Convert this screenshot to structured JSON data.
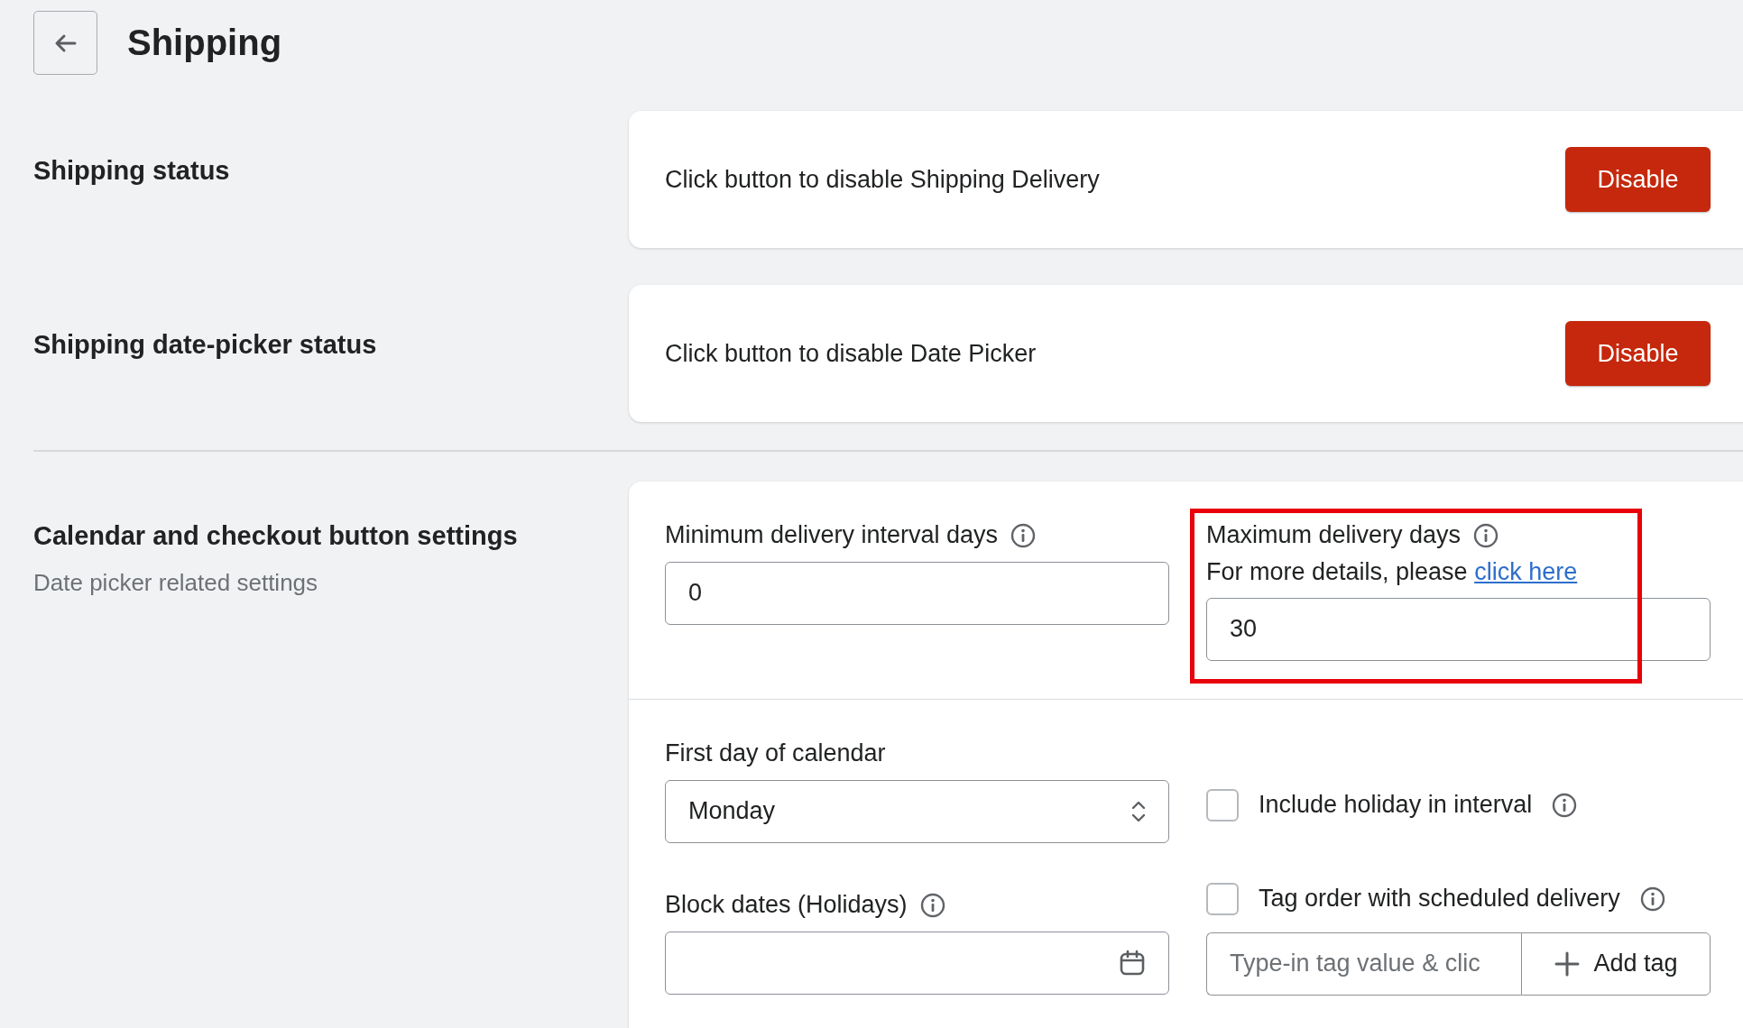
{
  "header": {
    "title": "Shipping"
  },
  "sections": [
    {
      "title": "Shipping status",
      "text": "Click button to disable Shipping Delivery",
      "button": "Disable"
    },
    {
      "title": "Shipping date-picker status",
      "text": "Click button to disable Date Picker",
      "button": "Disable"
    }
  ],
  "settings": {
    "title": "Calendar and checkout button settings",
    "subtitle": "Date picker related settings",
    "min_interval": {
      "label": "Minimum delivery interval days",
      "value": "0"
    },
    "max_days": {
      "label": "Maximum delivery days",
      "hint": "For more details, please",
      "link": "click here",
      "value": "30"
    },
    "first_day": {
      "label": "First day of calendar",
      "value": "Monday"
    },
    "block_dates": {
      "label": "Block dates (Holidays)"
    },
    "include_holiday": {
      "label": "Include holiday in interval",
      "checked": false
    },
    "tag_order": {
      "label": "Tag order with scheduled delivery",
      "checked": false,
      "placeholder": "Type-in tag value & clic",
      "button": "Add tag"
    }
  }
}
